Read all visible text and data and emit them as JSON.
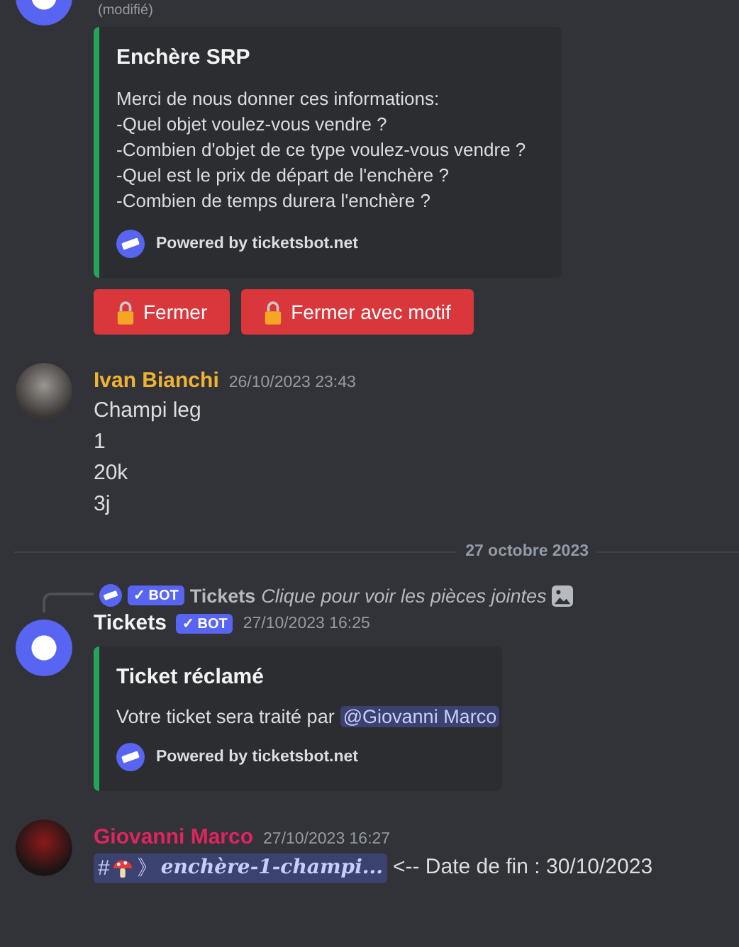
{
  "messages": [
    {
      "kind": "embed_top",
      "edited": "(modifié)",
      "embed": {
        "title": "Enchère SRP",
        "lines": [
          "Merci de nous donner ces informations:",
          "-Quel objet voulez-vous vendre ?",
          "-Combien d'objet de ce type voulez-vous vendre ?",
          "-Quel est le prix de départ de l'enchère ?",
          "-Combien de temps durera l'enchère ?"
        ],
        "footer": "Powered by ticketsbot.net"
      },
      "buttons": [
        "Fermer",
        "Fermer avec motif"
      ]
    },
    {
      "kind": "text",
      "author": "Ivan Bianchi",
      "color": "#f0b232",
      "time": "26/10/2023 23:43",
      "lines": [
        "Champi leg",
        "1",
        "20k",
        "3j"
      ]
    },
    {
      "kind": "divider",
      "date": "27 octobre 2023"
    },
    {
      "kind": "bot_reply",
      "reply": {
        "badge": "✓ BOT",
        "author": "Tickets",
        "text": "Clique pour voir les pièces jointes"
      },
      "author": "Tickets",
      "badge": "✓ BOT",
      "time": "27/10/2023 16:25",
      "embed": {
        "title": "Ticket réclamé",
        "text": "Votre ticket sera traité par",
        "mention": "@Giovanni Marco",
        "footer": "Powered by ticketsbot.net"
      }
    },
    {
      "kind": "channel",
      "author": "Giovanni Marco",
      "color": "#e0245e",
      "time": "27/10/2023 16:27",
      "channel": {
        "hash": "#",
        "sep": "》",
        "name": "enchère-1-champi..."
      },
      "text": "<-- Date de fin : 30/10/2023"
    }
  ]
}
